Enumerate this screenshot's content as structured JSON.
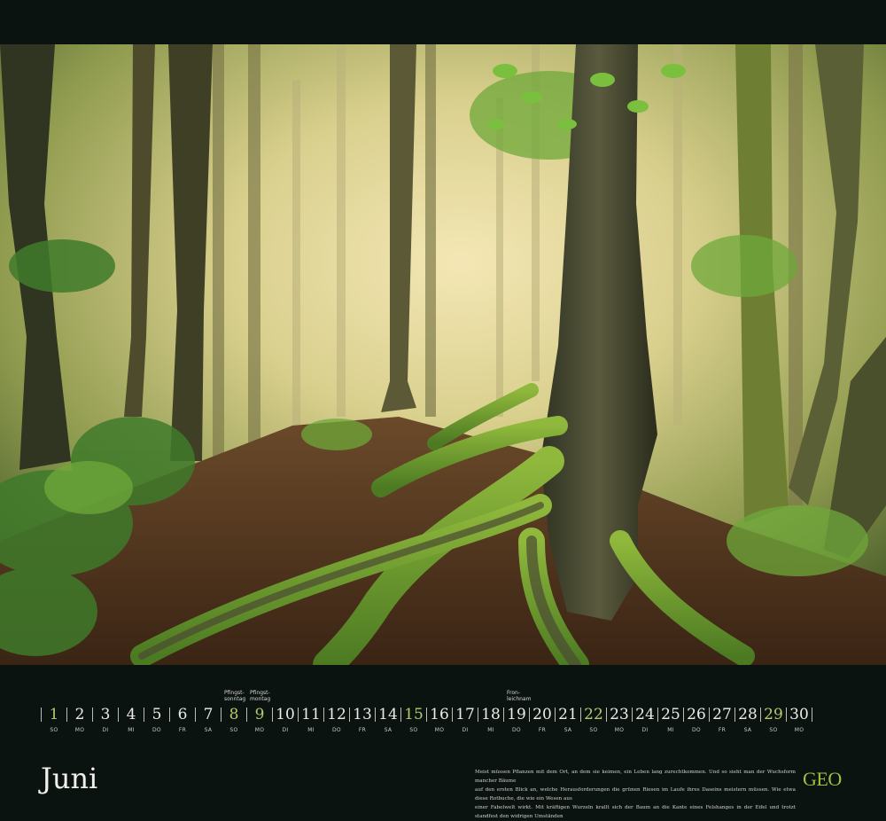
{
  "calendar": {
    "month": "Juni",
    "days": [
      {
        "n": "1",
        "wd": "SO",
        "hl": true
      },
      {
        "n": "2",
        "wd": "MO"
      },
      {
        "n": "3",
        "wd": "DI"
      },
      {
        "n": "4",
        "wd": "MI"
      },
      {
        "n": "5",
        "wd": "DO"
      },
      {
        "n": "6",
        "wd": "FR"
      },
      {
        "n": "7",
        "wd": "SA"
      },
      {
        "n": "8",
        "wd": "SO",
        "hl": true,
        "holiday": "Pfingst-\nsonntag"
      },
      {
        "n": "9",
        "wd": "MO",
        "hl": true,
        "holiday": "Pfingst-\nmontag"
      },
      {
        "n": "10",
        "wd": "DI"
      },
      {
        "n": "11",
        "wd": "MI"
      },
      {
        "n": "12",
        "wd": "DO"
      },
      {
        "n": "13",
        "wd": "FR"
      },
      {
        "n": "14",
        "wd": "SA"
      },
      {
        "n": "15",
        "wd": "SO",
        "hl": true
      },
      {
        "n": "16",
        "wd": "MO"
      },
      {
        "n": "17",
        "wd": "DI"
      },
      {
        "n": "18",
        "wd": "MI"
      },
      {
        "n": "19",
        "wd": "DO",
        "holiday": "Fron-\nleichnam"
      },
      {
        "n": "20",
        "wd": "FR"
      },
      {
        "n": "21",
        "wd": "SA"
      },
      {
        "n": "22",
        "wd": "SO",
        "hl": true
      },
      {
        "n": "23",
        "wd": "MO"
      },
      {
        "n": "24",
        "wd": "DI"
      },
      {
        "n": "25",
        "wd": "MI"
      },
      {
        "n": "26",
        "wd": "DO"
      },
      {
        "n": "27",
        "wd": "FR"
      },
      {
        "n": "28",
        "wd": "SA"
      },
      {
        "n": "29",
        "wd": "SO",
        "hl": true
      },
      {
        "n": "30",
        "wd": "MO"
      }
    ]
  },
  "caption": {
    "line1": "Meist müssen Pflanzen mit dem Ort, an dem sie keimen, ein Leben lang zurechtkommen. Und so sieht man der Wuchsform mancher Bäume",
    "line2": "auf den ersten Blick an, welche Herausforderungen die grünen Riesen im Laufe ihres Daseins meistern müssen. Wie etwa diese Rotbuche, die wie ein Wesen aus",
    "line3": "einer Fabelwelt wirkt. Mit kräftigen Wurzeln krallt sich der Baum an die Kante eines Felshanges in der Eifel und trotzt standfest den widrigen Umständen"
  },
  "brand": {
    "logo": "GEO",
    "color": "#9fc03a"
  },
  "colors": {
    "background": "#0b1311",
    "highlight": "#b8c96a",
    "text": "#ecebe5"
  }
}
